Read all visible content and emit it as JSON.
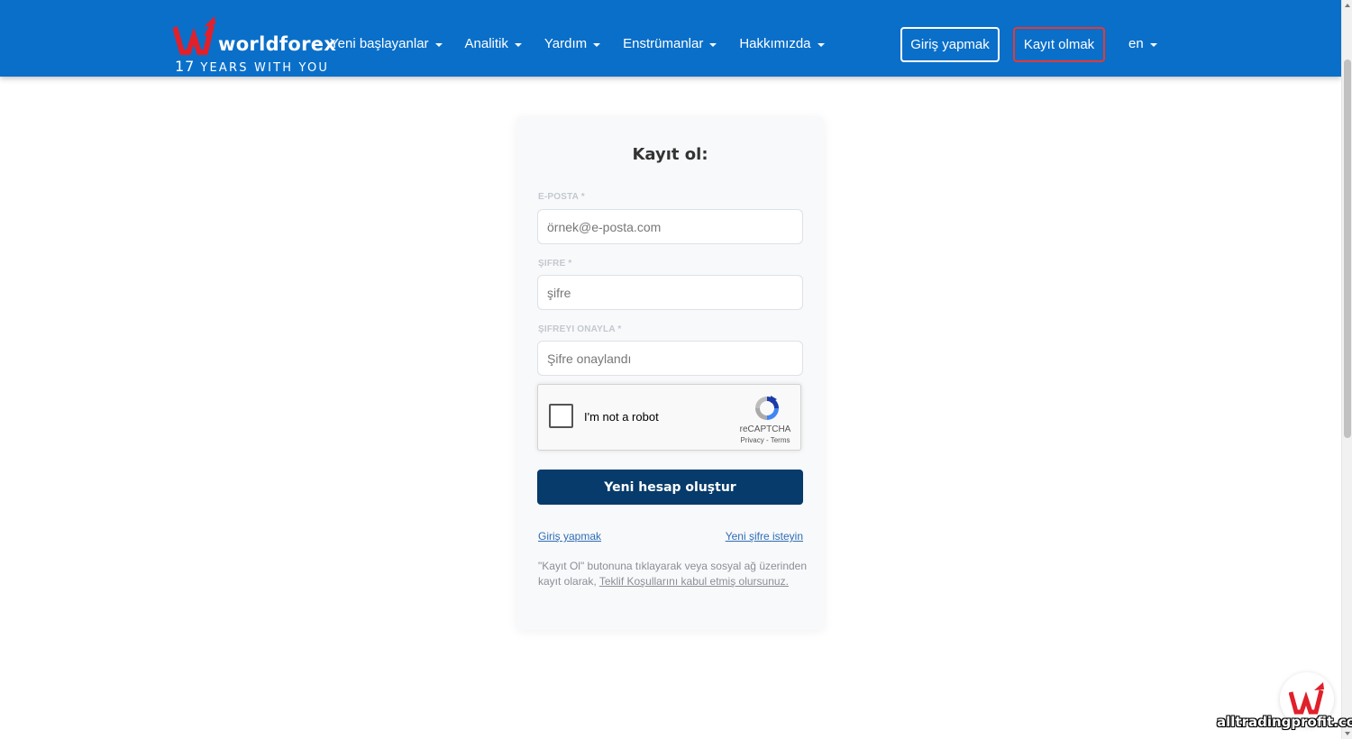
{
  "header": {
    "logo_text": "worldforex",
    "logo_tagline_number": "17",
    "logo_tagline": "YEARS WITH YOU",
    "nav": [
      {
        "label": "Yeni başlayanlar"
      },
      {
        "label": "Analitik"
      },
      {
        "label": "Yardım"
      },
      {
        "label": "Enstrümanlar"
      },
      {
        "label": "Hakkımızda"
      }
    ],
    "login_label": "Giriş yapmak",
    "register_label": "Kayıt olmak",
    "language": "en",
    "background_color": "#0a6fc9",
    "register_border_color": "#e53935"
  },
  "form": {
    "title": "Kayıt ol:",
    "email_label": "E-POSTA *",
    "email_placeholder": "örnek@e-posta.com",
    "password_label": "ŞIFRE *",
    "password_placeholder": "şifre",
    "confirm_label": "ŞIFREYI ONAYLA *",
    "confirm_placeholder": "Şifre onaylandı",
    "submit_label": "Yeni hesap oluştur",
    "submit_color": "#063b6b",
    "login_link": "Giriş yapmak",
    "reset_link": "Yeni şifre isteyin",
    "terms_prefix": "\"Kayıt Ol\" butonuna tıklayarak veya sosyal ağ üzerinden kayıt olarak, ",
    "terms_link": "Teklif Koşullarını kabul etmiş olursunuz."
  },
  "recaptcha": {
    "label": "I'm not a robot",
    "brand": "reCAPTCHA",
    "links": "Privacy - Terms"
  },
  "watermark": "alltradingprofit.com"
}
